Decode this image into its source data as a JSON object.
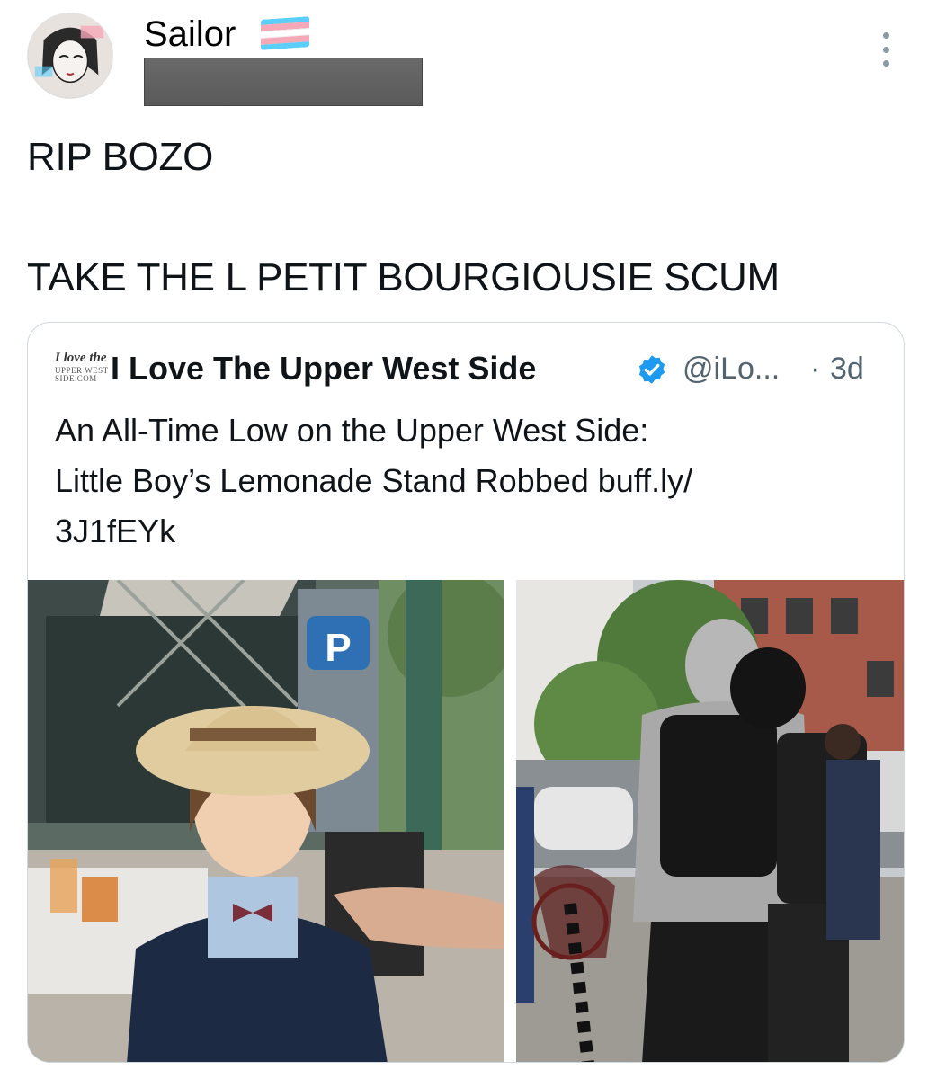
{
  "post": {
    "author": {
      "display_name": "Sailor",
      "flag_colors": [
        "#5BCEFA",
        "#F5A9B8",
        "#FFFFFF",
        "#F5A9B8",
        "#5BCEFA"
      ]
    },
    "menu_icon": "more-vertical-icon",
    "body_lines": [
      "RIP BOZO",
      "TAKE THE L PETIT BOURGIOUSIE SCUM"
    ],
    "quote": {
      "avatar_lines": [
        "I love the",
        "UPPER WEST SIDE.COM"
      ],
      "name": "I Love The Upper West Side",
      "verified_color": "#1d9bf0",
      "handle": "@iLo...",
      "dot": "·",
      "time": "3d",
      "text_lines": [
        "An All-Time Low on the Upper West Side:",
        "Little Boy’s Lemonade Stand Robbed buff.ly/",
        "3J1fEYk"
      ],
      "images": [
        "crying-boy-photo",
        "hooded-figures-photo"
      ]
    }
  }
}
